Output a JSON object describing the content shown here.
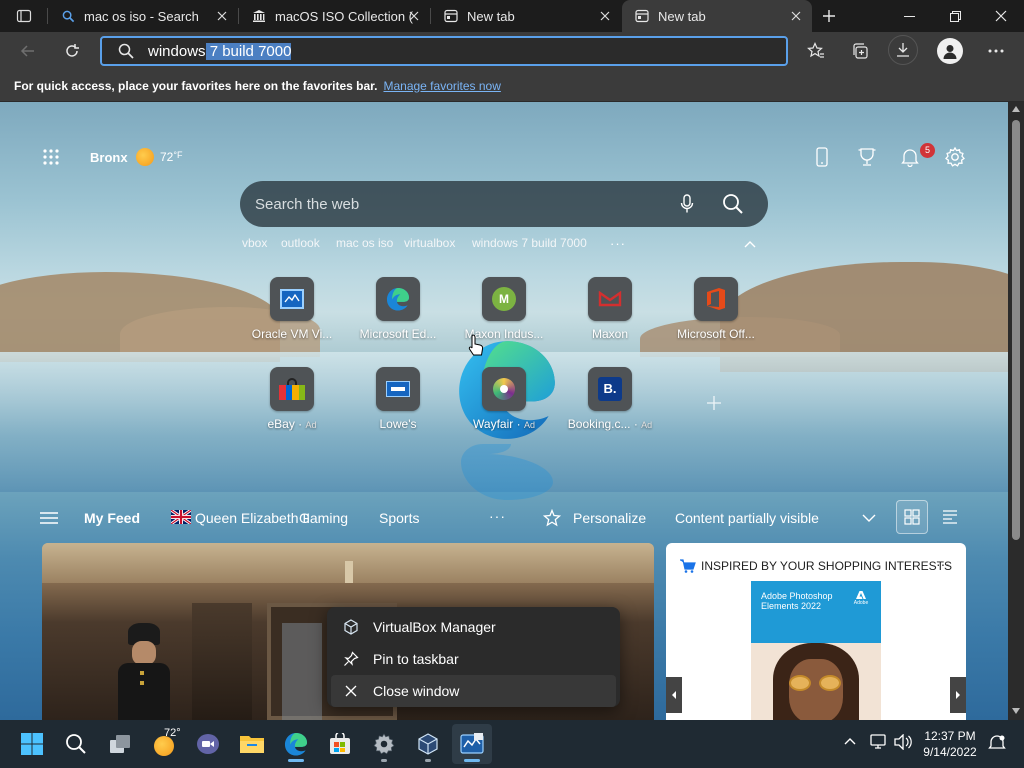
{
  "tabs": [
    {
      "label": "mac os iso - Search",
      "icon": "search-icon"
    },
    {
      "label": "macOS ISO Collection (",
      "icon": "bank-icon"
    },
    {
      "label": "New tab",
      "icon": "newtab-icon"
    },
    {
      "label": "New tab",
      "icon": "newtab-icon",
      "active": true
    }
  ],
  "address": {
    "typed": "windows",
    "autocomplete": " 7 build 7000"
  },
  "favorites_bar": {
    "text": "For quick access, place your favorites here on the favorites bar.",
    "link": "Manage favorites now"
  },
  "ntp": {
    "location": "Bronx",
    "temp": "72",
    "temp_unit": "°F",
    "notifications": "5",
    "search_placeholder": "Search the web",
    "trending": [
      "vbox",
      "outlook",
      "mac os iso",
      "virtualbox",
      "windows 7 build 7000"
    ],
    "quick_links": [
      {
        "label": "Oracle VM Vi...",
        "icon": "virtualbox-icon"
      },
      {
        "label": "Microsoft Ed...",
        "icon": "edge-icon"
      },
      {
        "label": "Maxon Indus...",
        "icon": "maxon-industries-icon",
        "letter": "M"
      },
      {
        "label": "Maxon",
        "icon": "maxon-icon"
      },
      {
        "label": "Microsoft Off...",
        "icon": "office-icon"
      },
      {
        "label": "eBay",
        "ad": "Ad",
        "icon": "ebay-icon"
      },
      {
        "label": "Lowe's",
        "icon": "lowes-icon"
      },
      {
        "label": "Wayfair",
        "ad": "Ad",
        "icon": "wayfair-icon"
      },
      {
        "label": "Booking.c...",
        "ad": "Ad",
        "icon": "booking-icon",
        "letter": "B."
      }
    ]
  },
  "feed": {
    "my_feed": "My Feed",
    "topics": [
      "Queen Elizabeth II",
      "Gaming",
      "Sports"
    ],
    "personalize": "Personalize",
    "visibility": "Content partially visible",
    "shopping_title": "INSPIRED BY YOUR SHOPPING INTERESTS",
    "product_line1": "Adobe Photoshop",
    "product_line2": "Elements 2022",
    "product_brand": "Adobe"
  },
  "context_menu": [
    {
      "label": "VirtualBox Manager",
      "icon": "virtualbox-cube-icon"
    },
    {
      "label": "Pin to taskbar",
      "icon": "pin-icon"
    },
    {
      "label": "Close window",
      "icon": "close-icon"
    }
  ],
  "taskbar": {
    "weather_temp": "72°",
    "time": "12:37 PM",
    "date": "9/14/2022"
  },
  "colors": {
    "accent": "#5aa0ea",
    "link": "#7ab4f5",
    "badge": "#d13438"
  }
}
